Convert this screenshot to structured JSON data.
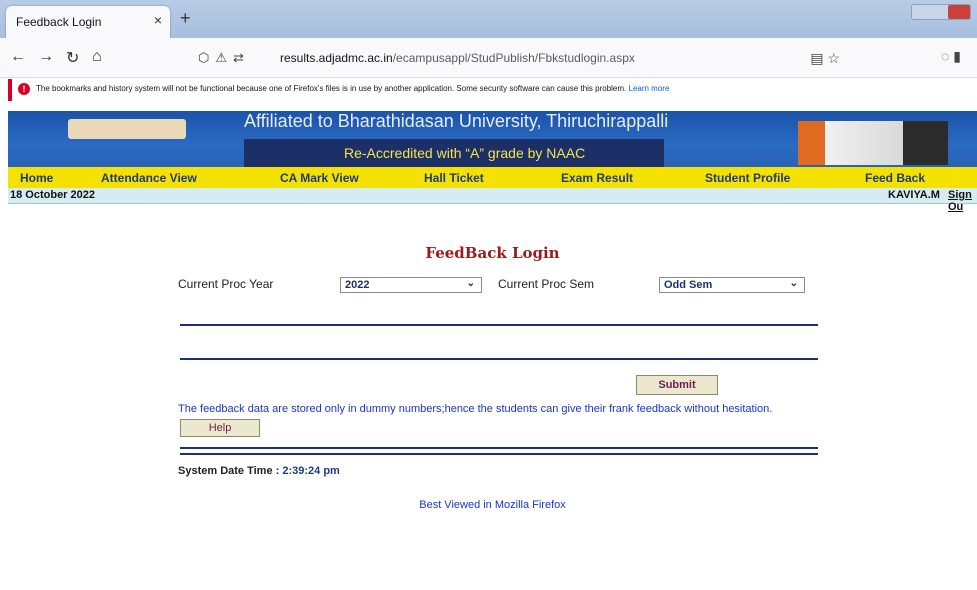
{
  "browser": {
    "tab_title": "Feedback Login",
    "url_domain": "results.adjadmc.ac.in",
    "url_path": "/ecampusappl/StudPublish/Fbkstudlogin.aspx",
    "notice_text": "The bookmarks and history system will not be functional because one of Firefox's files is in use by another application. Some security software can cause this problem.",
    "notice_link": "Learn more"
  },
  "banner": {
    "line1": "Affiliated to Bharathidasan University, Thiruchirappalli",
    "line2": "Re-Accredited with “A” grade by NAAC"
  },
  "menu": {
    "items": [
      "Home",
      "Attendance View",
      "CA Mark View",
      "Hall Ticket",
      "Exam Result",
      "Student Profile",
      "Feed Back"
    ]
  },
  "status": {
    "date": "18 October 2022",
    "user": "KAVIYA.M",
    "signout": "Sign Ou"
  },
  "form": {
    "title": "FeedBack Login",
    "year_label": "Current Proc Year",
    "year_value": "2022",
    "sem_label": "Current Proc Sem",
    "sem_value": "Odd Sem",
    "submit_label": "Submit",
    "help_label": "Help",
    "message": "The feedback data are stored only in dummy numbers;hence the students can give their frank feedback without hesitation."
  },
  "footer": {
    "sysdate_label": "System Date Time :",
    "sysdate_value": "2:39:24 pm",
    "best_viewed": "Best Viewed in Mozilla Firefox"
  },
  "colors": {
    "menu_bg": "#f5e100",
    "title_red": "#9b1b1b",
    "link_blue": "#1a35c8",
    "banner_blue": "#1b53a8"
  }
}
